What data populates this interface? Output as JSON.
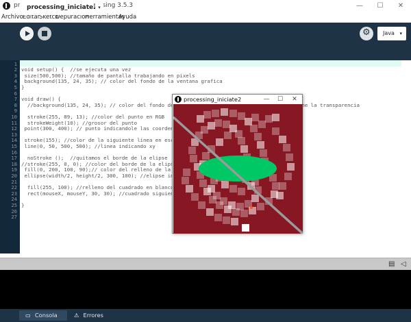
{
  "window": {
    "title": "processing_iniciate2 | Processing 3.5.3",
    "minimize_glyph": "—",
    "maximize_glyph": "☐",
    "close_glyph": "✕"
  },
  "menubar": {
    "items": [
      "Archivo",
      "Editar",
      "Sketch",
      "Depuración",
      "Herramientas",
      "Ayuda"
    ]
  },
  "toolbar": {
    "run_icon": "play-icon",
    "stop_icon": "stop-icon",
    "debug_icon": "debugger-icon",
    "mode_label": "Java",
    "mode_caret": "▾"
  },
  "tabs": {
    "active_label": "processing_iniciate2",
    "menu_glyph": "▾"
  },
  "editor": {
    "line_numbers": [
      "1",
      "2",
      "3",
      "4",
      "5",
      "6",
      "7",
      "8",
      "9",
      "10",
      "11",
      "12",
      "13",
      "14",
      "15",
      "16",
      "17",
      "18",
      "19",
      "20",
      "21",
      "22",
      "23",
      "24",
      "25",
      "26",
      "27"
    ],
    "lines": [
      "",
      "void setup() {  //se ejecuta una vez",
      " size(500,500); //tamaño de pantalla trabajando en pixels",
      " background(135, 24, 35); // color del fondo de la ventana grafica",
      "}",
      "",
      "void draw() {",
      "  //background(135, 24, 35); // color del fondo de la ventana grafica, si se quita se mantiene la transparencia",
      "",
      "  stroke(255, 89, 13); //color del punto en RGB",
      "  strokeWeight(10); //grosor del punto",
      " point(300, 400); // punto indicandole las coordenadas",
      "",
      " stroke(155); //color de la siguiente linea en escala",
      " line(0, 50, 500, 500); //linea indicando xy",
      "",
      "  noStroke ();  //quitamos el borde de la elipse",
      "//stroke(255, 0, 0); //color del borde de la elipse",
      " fill(0, 200, 100, 90);// color del relleno de la elipse RGB, alpha es el valor",
      " ellipse(width/2, height/2, 300, 100); //elipse indicando coordenadas x y",
      "",
      "  fill(255, 100); //relleno del cuadrado en blanco",
      "  rect(mouseX, mouseY, 30, 30); //cuadrado siguiendo el mouse",
      "",
      "}",
      "",
      ""
    ]
  },
  "sketch_window": {
    "title": "processing_iniciate2",
    "minimize_glyph": "—",
    "maximize_glyph": "☐",
    "close_glyph": "✕",
    "background_color": "#871823",
    "ellipse_color": "#00c864",
    "line_color": "#9b9b9b",
    "point_color": "#ff590d"
  },
  "console": {
    "console_tab_label": "Consola",
    "errors_tab_label": "Errores",
    "copy_icon": "clipboard-icon",
    "collapse_icon": "triangle-left-icon"
  }
}
